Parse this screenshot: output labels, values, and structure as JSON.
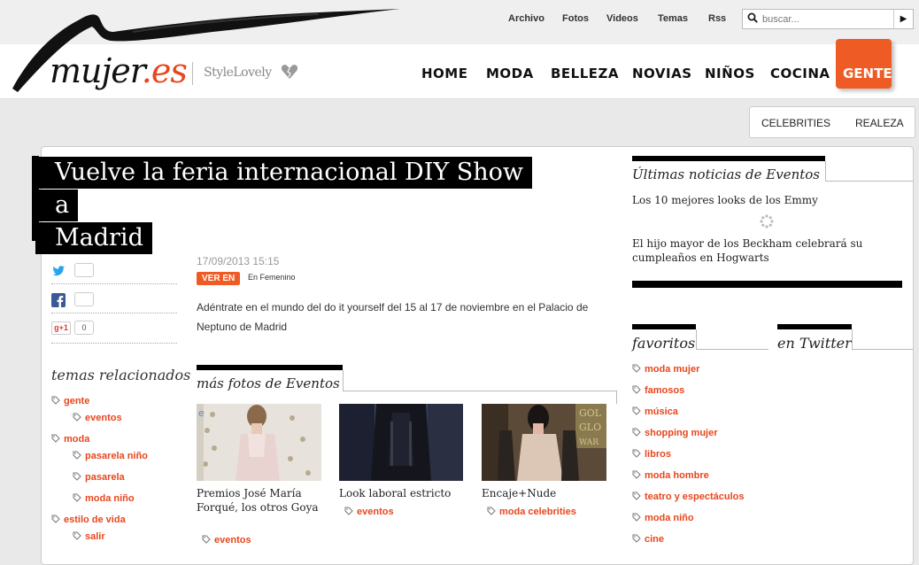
{
  "topbar": {
    "links": [
      "Archivo",
      "Fotos",
      "Videos",
      "Temas",
      "Rss"
    ],
    "search_placeholder": "buscar...",
    "search_go": "▶"
  },
  "brand": {
    "logo_main": "mujer",
    "logo_dot": ".es",
    "partner": "StyleLovely"
  },
  "nav": {
    "items": [
      "HOME",
      "MODA",
      "BELLEZA",
      "NOVIAS",
      "NIÑOS",
      "COCINA",
      "GENTE"
    ],
    "active": "GENTE",
    "sub_items": [
      "CELEBRITIES",
      "REALEZA"
    ]
  },
  "colors": {
    "accent": "#ef5b24",
    "link": "#e8461c",
    "text": "#222222"
  },
  "article": {
    "title_line1": "Vuelve la feria internacional DIY Show a",
    "title_line2": "Madrid",
    "date": "17/09/2013 15:15",
    "badge": "VER EN",
    "badge_target": "En Femenino",
    "lead": "Adéntrate en el mundo del do it yourself del 15 al 17 de noviembre en el Palacio de Neptuno de Madrid"
  },
  "share": {
    "twitter_count": "",
    "facebook_count": "",
    "gplus_label": "+1",
    "gplus_count": "0"
  },
  "related": {
    "heading": "temas relacionados",
    "tags": [
      {
        "label": "gente"
      },
      {
        "label": "eventos"
      },
      {
        "label": "moda"
      },
      {
        "label": "pasarela niño"
      },
      {
        "label": "pasarela"
      },
      {
        "label": "moda niño"
      },
      {
        "label": "estilo de vida"
      },
      {
        "label": "salir"
      }
    ]
  },
  "more_photos": {
    "heading": "más fotos de Eventos",
    "items": [
      {
        "caption": "Premios José María Forqué, los otros Goya",
        "tag": "eventos"
      },
      {
        "caption": "Look laboral estricto",
        "tag": "eventos"
      },
      {
        "caption": "Encaje+Nude",
        "tag": "moda celebrities"
      }
    ]
  },
  "sidebar": {
    "news_heading": "Últimas noticias de Eventos",
    "news": [
      "Los 10 mejores looks de los Emmy",
      "El hijo mayor de los Beckham celebrará su cumpleaños en Hogwarts"
    ],
    "favorites_heading": "favoritos",
    "twitter_heading": "en Twitter",
    "favorites": [
      "moda mujer",
      "famosos",
      "música",
      "shopping mujer",
      "libros",
      "moda hombre",
      "teatro y espectáculos",
      "moda niño",
      "cine"
    ]
  }
}
